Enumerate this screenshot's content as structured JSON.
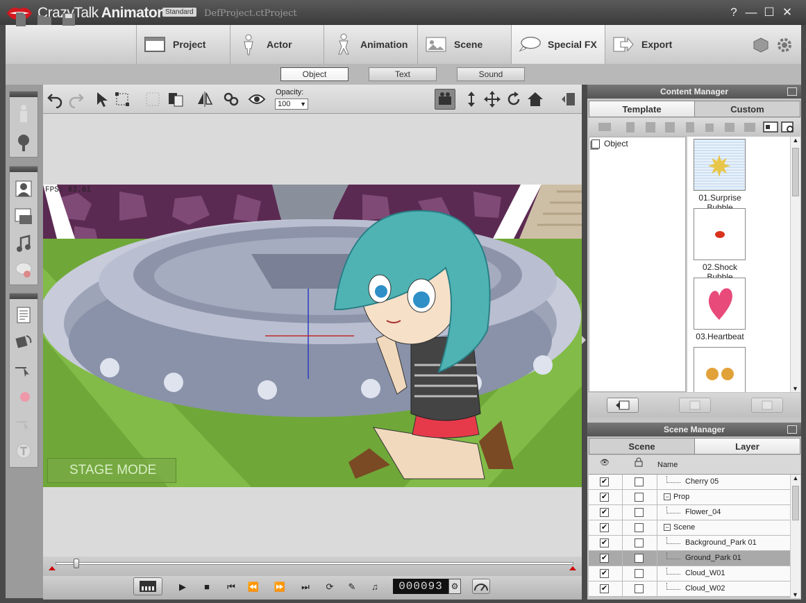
{
  "app": {
    "brand_light": "CrazyTalk",
    "brand_bold": "Animator",
    "edition": "Standard",
    "project_name": "DefProject.ctProject"
  },
  "window_controls": {
    "help": "?",
    "minimize": "—",
    "maximize": "☐",
    "close": "✕"
  },
  "main_tabs": [
    {
      "label": "Project",
      "icon": "project-icon"
    },
    {
      "label": "Actor",
      "icon": "actor-icon"
    },
    {
      "label": "Animation",
      "icon": "animation-icon"
    },
    {
      "label": "Scene",
      "icon": "scene-icon"
    },
    {
      "label": "Special FX",
      "icon": "speech-bubble-icon",
      "active": true
    },
    {
      "label": "Export",
      "icon": "export-icon"
    }
  ],
  "sub_tabs": [
    {
      "label": "Object",
      "active": true
    },
    {
      "label": "Text"
    },
    {
      "label": "Sound"
    }
  ],
  "toolbar": {
    "opacity_label": "Opacity:",
    "opacity_value": "100"
  },
  "stage": {
    "fps": "FPS: 62.61",
    "mode_label": "STAGE MODE"
  },
  "playback": {
    "frame_counter": "000093"
  },
  "content_manager": {
    "title": "Content Manager",
    "tabs": [
      {
        "label": "Template"
      },
      {
        "label": "Custom",
        "active": true
      }
    ],
    "tree_root": "Object",
    "items": [
      {
        "label": "01.Surprise Bubble",
        "selected": true
      },
      {
        "label": "02.Shock Bubble"
      },
      {
        "label": "03.Heartbeat"
      },
      {
        "label": ""
      }
    ]
  },
  "scene_manager": {
    "title": "Scene Manager",
    "tabs": [
      {
        "label": "Scene",
        "active": true
      },
      {
        "label": "Layer"
      }
    ],
    "name_header": "Name",
    "rows": [
      {
        "name": "Cherry 05",
        "visible": true,
        "depth": 2,
        "type": "leaf"
      },
      {
        "name": "Prop",
        "visible": true,
        "depth": 1,
        "type": "group"
      },
      {
        "name": "Flower_04",
        "visible": true,
        "depth": 2,
        "type": "leaf"
      },
      {
        "name": "Scene",
        "visible": true,
        "depth": 1,
        "type": "group"
      },
      {
        "name": "Background_Park 01",
        "visible": true,
        "depth": 2,
        "type": "leaf"
      },
      {
        "name": "Ground_Park 01",
        "visible": true,
        "depth": 2,
        "type": "leaf",
        "selected": true
      },
      {
        "name": "Cloud_W01",
        "visible": true,
        "depth": 2,
        "type": "leaf"
      },
      {
        "name": "Cloud_W02",
        "visible": true,
        "depth": 2,
        "type": "leaf"
      }
    ]
  },
  "colors": {
    "accent_red": "#c8202a",
    "panel_header": "#5a5a5a",
    "grass": "#6fa838",
    "hair": "#4fb3b3"
  }
}
